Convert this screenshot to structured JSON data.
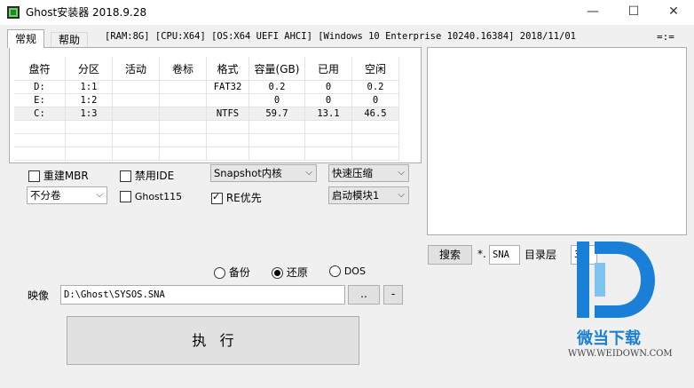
{
  "window": {
    "title": "Ghost安装器 2018.9.28",
    "minimize_glyph": "—",
    "maximize_glyph": "☐",
    "close_glyph": "✕"
  },
  "tabs": [
    {
      "label": "常规",
      "active": true
    },
    {
      "label": "帮助",
      "active": false
    }
  ],
  "system_info": "[RAM:8G] [CPU:X64] [OS:X64 UEFI AHCI] [Windows 10 Enterprise 10240.16384] 2018/11/01",
  "menu_dots": "=:=",
  "disk_table": {
    "headers": [
      "盘符",
      "分区",
      "活动",
      "卷标",
      "格式",
      "容量(GB)",
      "已用",
      "空闲"
    ],
    "rows": [
      [
        "D:",
        "1:1",
        "",
        "",
        "FAT32",
        "0.2",
        "0",
        "0.2"
      ],
      [
        "E:",
        "1:2",
        "",
        "",
        "",
        "0",
        "0",
        "0"
      ],
      [
        "C:",
        "1:3",
        "",
        "",
        "NTFS",
        "59.7",
        "13.1",
        "46.5"
      ]
    ],
    "selected_row": 2
  },
  "options": {
    "rebuild_mbr": {
      "label": "重建MBR",
      "checked": false
    },
    "disable_ide": {
      "label": "禁用IDE",
      "checked": false
    },
    "ghost115": {
      "label": "Ghost115",
      "checked": false
    },
    "re_priority": {
      "label": "RE优先",
      "checked": true
    },
    "kernel_select": "Snapshot内核",
    "compress_select": "快速压缩",
    "volume_select": "不分卷",
    "boot_module_select": "启动模块1"
  },
  "mode": {
    "backup": "备份",
    "restore": "还原",
    "dos": "DOS",
    "selected": "restore"
  },
  "image": {
    "label": "映像",
    "path": "D:\\Ghost\\SYSOS.SNA",
    "browse_label": "..",
    "minus_label": "-"
  },
  "execute_label": "执   行",
  "search": {
    "button_label": "搜索",
    "ext_prefix": "*.",
    "ext_value": "SNA",
    "depth_label": "目录层",
    "depth_value": "3"
  },
  "watermark": {
    "brand": "微当下载",
    "url": "WWW.WEIDOWN.COM",
    "color": "#1a7fd6"
  }
}
